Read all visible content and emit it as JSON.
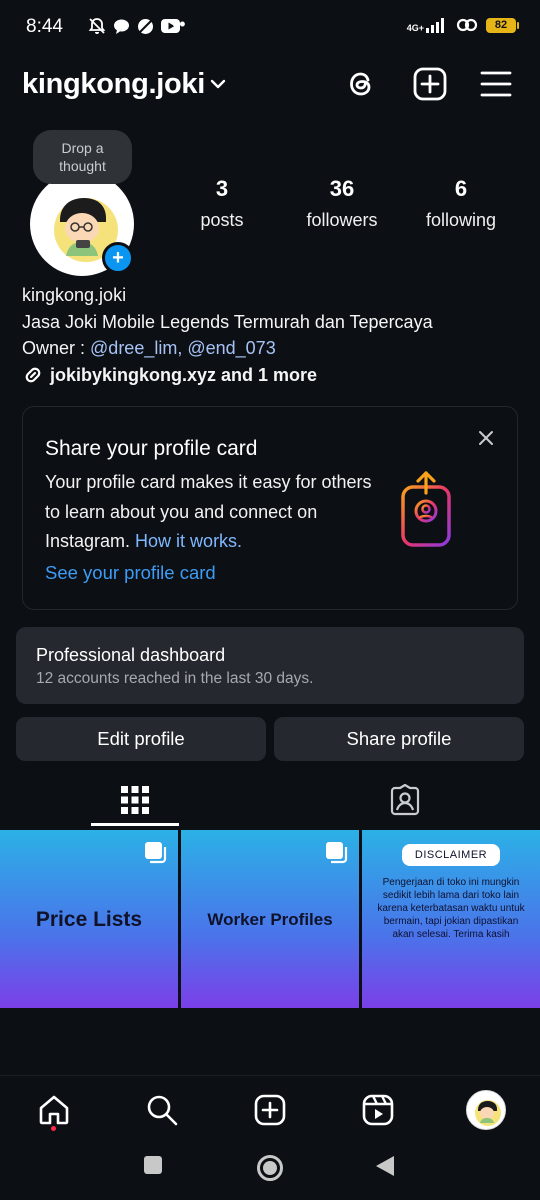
{
  "status_bar": {
    "time": "8:44",
    "network": "4G+",
    "battery": "82",
    "dots": "••",
    "icons": [
      "silent-bell-icon",
      "chat-bubble-icon",
      "ball-icon",
      "youtube-icon",
      "signal-icon",
      "hotspot-icon",
      "battery-icon"
    ]
  },
  "header": {
    "username": "kingkong.joki",
    "icons": [
      "threads-icon",
      "new-post-icon",
      "menu-icon"
    ]
  },
  "profile": {
    "thought_bubble": "Drop a thought",
    "stats": [
      {
        "value": "3",
        "label": "posts"
      },
      {
        "value": "36",
        "label": "followers"
      },
      {
        "value": "6",
        "label": "following"
      }
    ],
    "name": "kingkong.joki",
    "bio_line": "Jasa Joki Mobile Legends Termurah dan Tepercaya",
    "owner_prefix": "Owner : ",
    "owner_mention_1": "@dree_lim",
    "owner_sep": ", ",
    "owner_mention_2": "@end_073",
    "link_text": "jokibykingkong.xyz and 1 more"
  },
  "profile_card": {
    "title": "Share your profile card",
    "body": "Your profile card makes it easy for others to learn about you and connect on Instagram. ",
    "how_link": "How it works.",
    "cta": "See your profile card"
  },
  "dashboard": {
    "title": "Professional dashboard",
    "subtitle": "12 accounts reached in the last 30 days."
  },
  "actions": {
    "edit": "Edit profile",
    "share": "Share profile"
  },
  "tabs": [
    "grid-tab-icon",
    "tagged-tab-icon"
  ],
  "posts": [
    {
      "label": "Price Lists"
    },
    {
      "label": "Worker Profiles"
    },
    {
      "badge": "DISCLAIMER",
      "text": "Pengerjaan di toko ini mungkin sedikit lebih lama dari toko lain karena keterbatasan waktu untuk bermain, tapi jokian dipastikan akan selesai. Terima kasih"
    }
  ],
  "bottom_nav": [
    "home-icon",
    "search-icon",
    "create-icon",
    "reels-icon",
    "profile-avatar"
  ],
  "colors": {
    "background": "#0c0f14",
    "surface": "#25282e",
    "accent_blue": "#0a95f0",
    "link_blue": "#3d9cf5",
    "mention": "#a7c3f5"
  }
}
